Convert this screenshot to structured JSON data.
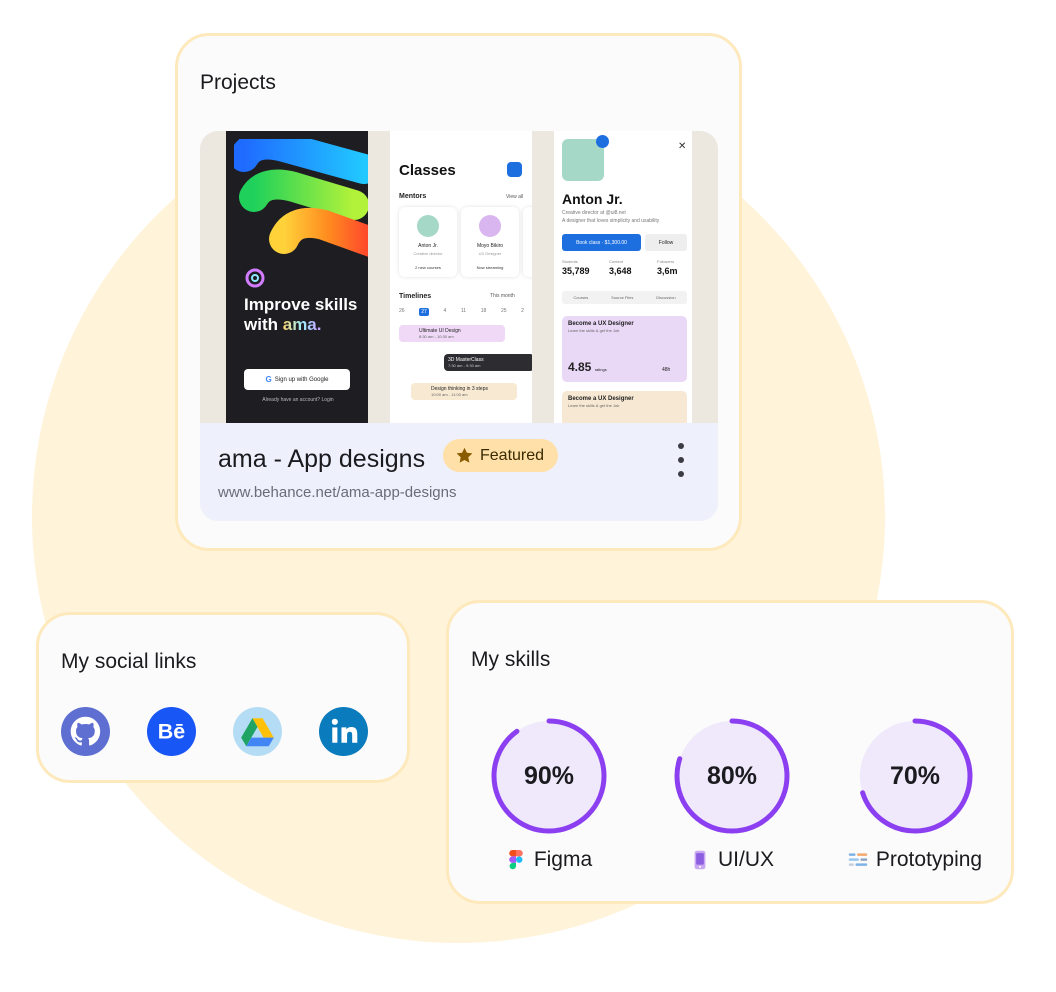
{
  "projects": {
    "title": "Projects",
    "item": {
      "name": "ama - App designs",
      "badge": "Featured",
      "url": "www.behance.net/ama-app-designs"
    },
    "preview": {
      "splash": {
        "headline": "Improve skills with",
        "brand": "ama.",
        "google_button": "Sign up with Google",
        "login_text": "Already have an account? Login"
      },
      "classes": {
        "title": "Classes",
        "mentors_label": "Mentors",
        "view_all": "View all",
        "mentors": [
          {
            "name": "Anton Jr.",
            "role": "Creative director",
            "stat": "2 new courses"
          },
          {
            "name": "Moyo Bikiro",
            "role": "UX Designer",
            "stat": "Now streaming"
          }
        ],
        "timeline_label": "Timelines",
        "month": "This month",
        "days": [
          "26",
          "27",
          "4",
          "11",
          "18",
          "25",
          "2"
        ],
        "events": [
          {
            "title": "Ultimate UI Design",
            "time": "8:30 am - 10:30 am"
          },
          {
            "title": "3D MasterClass",
            "time": "7:30 am - 9:30 am"
          },
          {
            "title": "Design thinking in 3 steps",
            "time": "10:00 am - 11:00 am"
          }
        ]
      },
      "profile": {
        "name": "Anton Jr.",
        "bio": "Creative director at @ui8.net",
        "tagline": "A designer that loves simplicity and usability",
        "book_button": "Book class · $1,300.00",
        "follow_button": "Follow",
        "stats": [
          {
            "label": "Students",
            "value": "35,789"
          },
          {
            "label": "Content",
            "value": "3,648"
          },
          {
            "label": "Followers",
            "value": "3,6m"
          }
        ],
        "tabs": [
          "Courses",
          "Source Files",
          "Discussion"
        ],
        "courses": [
          {
            "title": "Become a UX Designer",
            "sub": "Learn the skills & get the Job",
            "rating": "4.85",
            "rating_label": "ratings",
            "hours": "48h"
          },
          {
            "title": "Become a UX Designer",
            "sub": "Learn the skills & get the Job"
          }
        ]
      }
    }
  },
  "social": {
    "title": "My social links",
    "links": [
      {
        "icon": "github-icon",
        "color": "#5f6fd1"
      },
      {
        "icon": "behance-icon",
        "color": "#1857f5"
      },
      {
        "icon": "google-drive-icon",
        "color": "#b5dcf5"
      },
      {
        "icon": "linkedin-icon",
        "color": "#0a7bbd"
      }
    ]
  },
  "skills": {
    "title": "My skills",
    "accent": "#8b3ff0",
    "track": "#efe9fb",
    "items": [
      {
        "name": "Figma",
        "percent_label": "90%",
        "percent": 90,
        "icon": "figma-icon"
      },
      {
        "name": "UI/UX",
        "percent_label": "80%",
        "percent": 80,
        "icon": "mobile-design-icon"
      },
      {
        "name": "Prototyping",
        "percent_label": "70%",
        "percent": 70,
        "icon": "prototyping-icon"
      }
    ]
  }
}
